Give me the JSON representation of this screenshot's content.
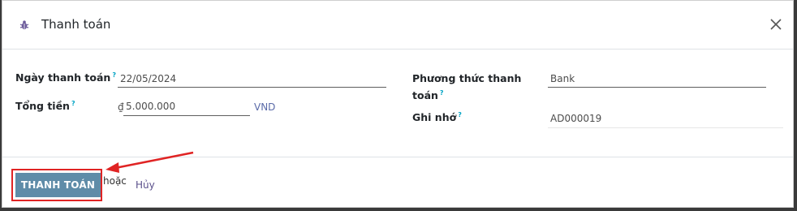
{
  "dialog": {
    "title": "Thanh toán",
    "icon": "bug-icon"
  },
  "fields": {
    "payment_date": {
      "label": "Ngày thanh toán",
      "help": "?",
      "value": "22/05/2024"
    },
    "amount": {
      "label": "Tổng tiền",
      "help": "?",
      "currency_symbol": "₫",
      "value": "5.000.000",
      "currency": "VND"
    },
    "payment_method": {
      "label_line1": "Phương thức thanh",
      "label_line2": "toán",
      "help": "?",
      "value": "Bank"
    },
    "memo": {
      "label": "Ghi nhớ",
      "help": "?",
      "value": "AD000019"
    }
  },
  "footer": {
    "pay_button": "THANH TOÁN",
    "or_text": "hoặc",
    "cancel_link": "Hủy"
  },
  "colors": {
    "primary_button": "#5f8ca8",
    "annotation_red": "#e02424",
    "help_marker": "#00a3c4"
  }
}
